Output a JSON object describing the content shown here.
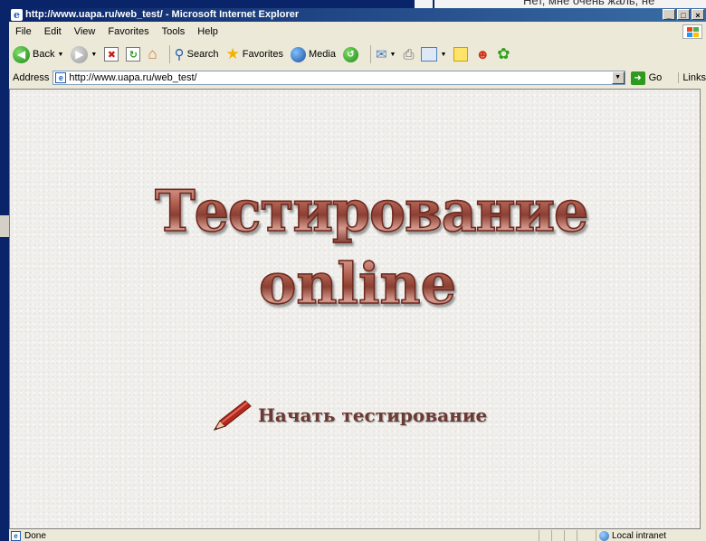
{
  "background": {
    "right_top_text": "Нет, мне очень жаль, не"
  },
  "window": {
    "title": "http://www.uapa.ru/web_test/ - Microsoft Internet Explorer",
    "controls": [
      "_",
      "□",
      "×"
    ]
  },
  "menu": {
    "items": [
      "File",
      "Edit",
      "View",
      "Favorites",
      "Tools",
      "Help"
    ]
  },
  "toolbar": {
    "back_label": "Back",
    "search_label": "Search",
    "favorites_label": "Favorites",
    "media_label": "Media"
  },
  "address": {
    "label": "Address",
    "url": "http://www.uapa.ru/web_test/",
    "go_label": "Go",
    "links_label": "Links"
  },
  "page": {
    "logo_line1": "Тестирование",
    "logo_line2": "online",
    "start_label": "Начать тестирование"
  },
  "status": {
    "text": "Done",
    "zone": "Local intranet"
  },
  "colors": {
    "titlebar": "#0a246a",
    "chrome": "#ece9d8",
    "logo": "#b46454",
    "link_text": "#6b3a34"
  }
}
